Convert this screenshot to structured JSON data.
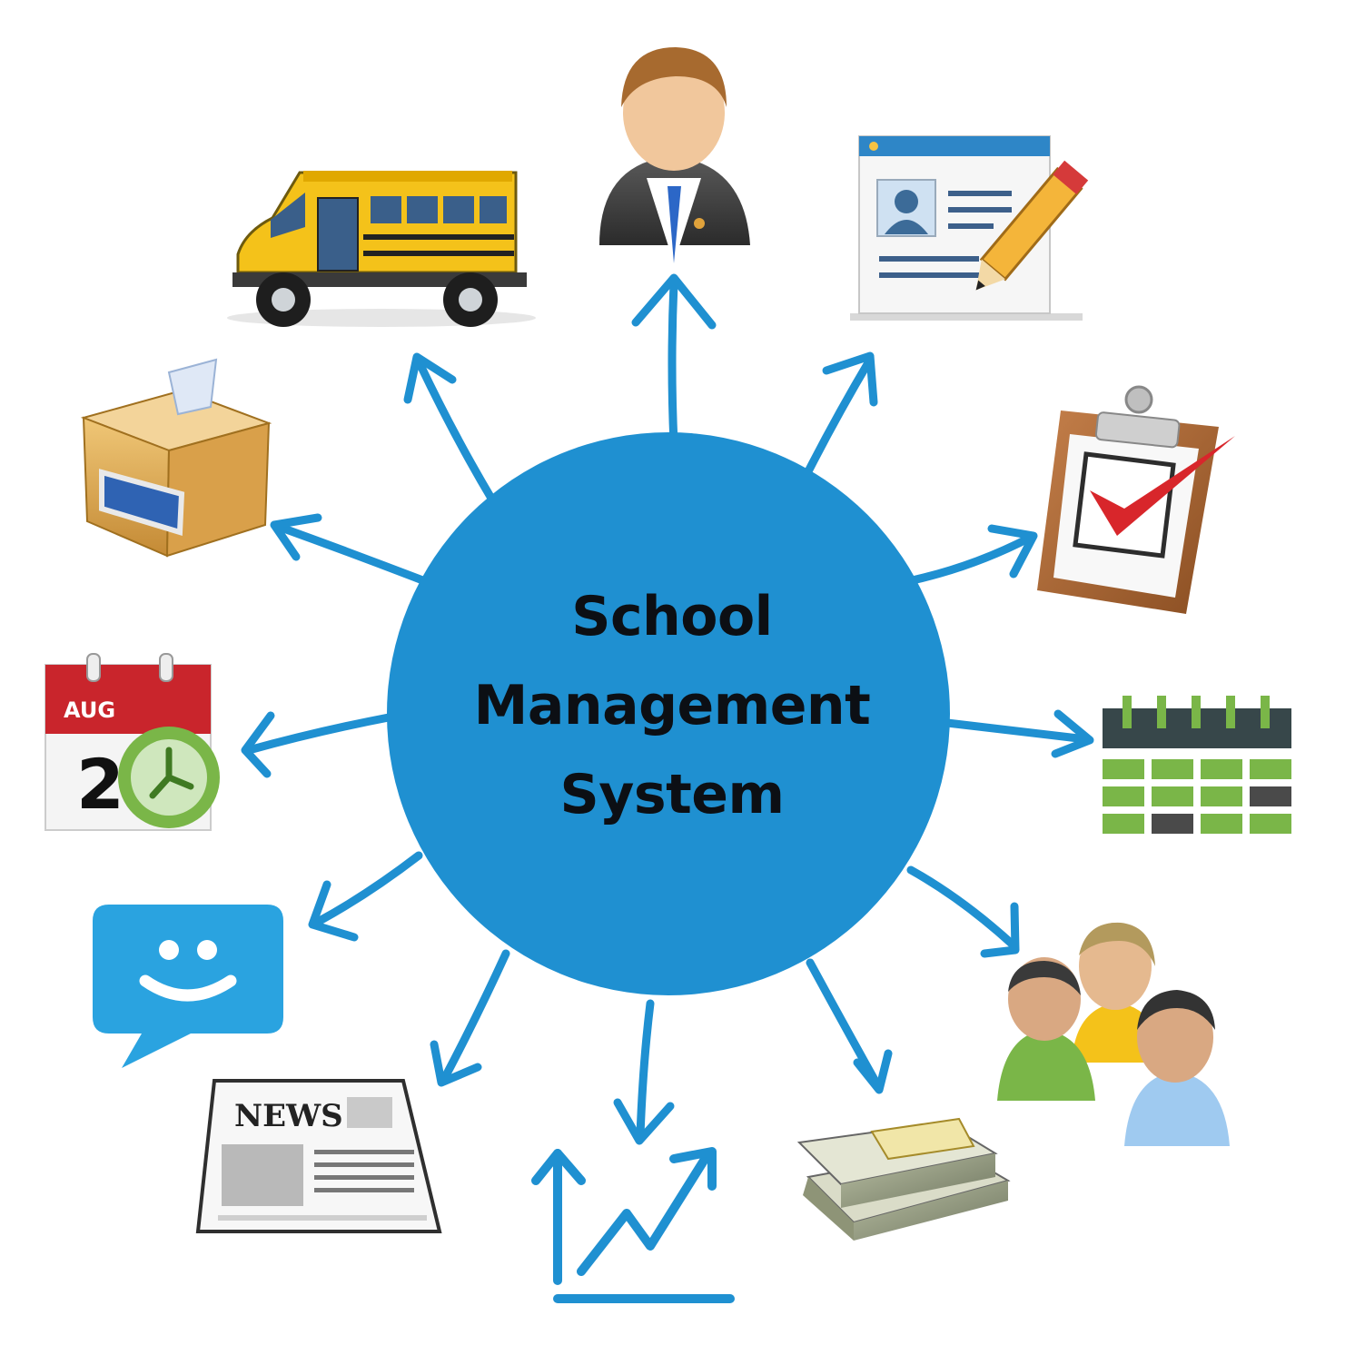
{
  "hub": {
    "lines": [
      "School",
      "Management",
      "System"
    ],
    "color": "#1f90d1"
  },
  "icons": {
    "newspaper_word": "NEWS",
    "calendar_month": "AUG",
    "calendar_day": "2"
  },
  "colors": {
    "arrow": "#1f90d1",
    "bus": "#f4c21a",
    "chat": "#2aa3e0",
    "calendar_green": "#7ab648",
    "check_red": "#d8262b",
    "calendar_red": "#c9252c"
  },
  "nodes": [
    {
      "name": "person-icon"
    },
    {
      "name": "profile-form-icon"
    },
    {
      "name": "attendance-checklist-icon"
    },
    {
      "name": "timetable-calendar-icon"
    },
    {
      "name": "parents-group-icon"
    },
    {
      "name": "fees-money-icon"
    },
    {
      "name": "reports-chart-icon"
    },
    {
      "name": "news-icon"
    },
    {
      "name": "message-chat-icon"
    },
    {
      "name": "events-calendar-icon"
    },
    {
      "name": "suggestion-box-icon"
    },
    {
      "name": "transport-bus-icon"
    }
  ]
}
